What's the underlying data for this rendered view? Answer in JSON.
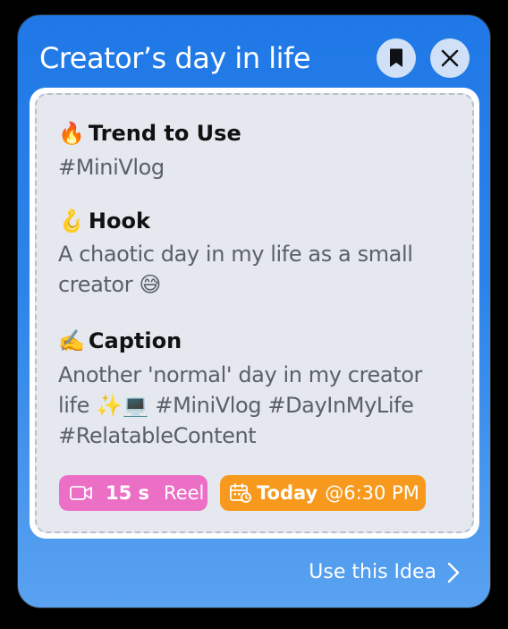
{
  "header": {
    "title": "Creator’s day in life"
  },
  "sections": {
    "trend": {
      "emoji": "🔥",
      "heading": "Trend to Use",
      "text": "#MiniVlog"
    },
    "hook": {
      "emoji": "🪝",
      "heading": "Hook",
      "text": "A chaotic day in my life as a small creator 😅"
    },
    "caption": {
      "emoji": "✍️",
      "heading": "Caption",
      "text": "Another 'normal' day in my creator life ✨💻 #MiniVlog #DayInMyLife #RelatableContent"
    }
  },
  "chips": {
    "reel": {
      "duration": "15 s",
      "kind": "Reel",
      "icon": "video-camera-icon",
      "color": "#ec6fc6"
    },
    "schedule": {
      "day": "Today",
      "time": "@6:30 PM",
      "icon": "calendar-clock-icon",
      "color": "#f7991c"
    }
  },
  "footer": {
    "action_label": "Use this Idea",
    "action_icon": "chevron-right-icon"
  },
  "colors": {
    "accent": "#1f78e6",
    "panel": "#e5e8ee"
  }
}
